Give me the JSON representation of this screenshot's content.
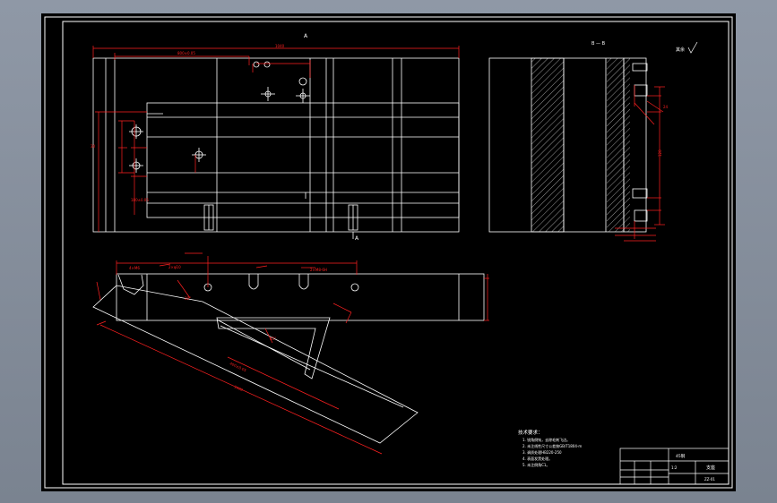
{
  "drawing": {
    "section_label_a": "A",
    "section_label_b": "A",
    "view_label": "B — B",
    "roughness_note": "其余",
    "dims": {
      "top_overall": "1040",
      "top_inner": "800±0.05",
      "left_vertical": "30",
      "left_height": "180±0.05",
      "callout_1": "4×M6",
      "callout_2": "2×φ10",
      "callout_3": "2×M8-6H",
      "slant_long": "1000",
      "slant_short": "400±0.05",
      "side_height": "120",
      "right_chain": "24",
      "angle_1": "45°",
      "angle_2": "30°"
    }
  },
  "notes": {
    "title": "技术要求：",
    "items": [
      "1. 锐角倒钝，去除毛刺飞边。",
      "2. 未注线性尺寸公差按GB/T1804-m",
      "3. 调质处理HB220-250",
      "4. 表面发黑处理。",
      "5. 未注倒角C1。"
    ]
  },
  "title_block": {
    "material": "45钢",
    "part_name": "支座",
    "drawing_no": "ZZ-01",
    "scale": "1:2"
  },
  "colors": {
    "sheet_bg": "#000000",
    "outline": "#ffffff",
    "dimension": "#ff2020",
    "desktop": "#8a93a0"
  }
}
